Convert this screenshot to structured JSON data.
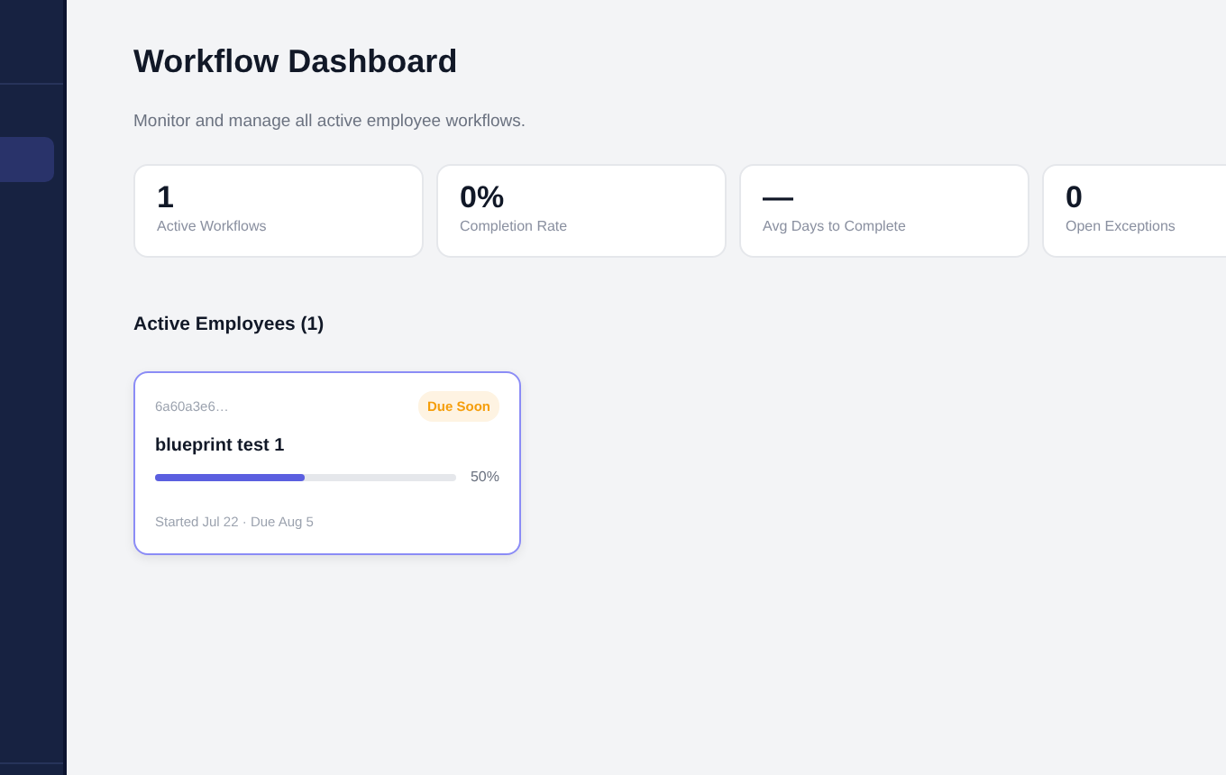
{
  "sidebar": {
    "items": [
      {
        "selected": true
      }
    ]
  },
  "page": {
    "title": "Workflow Dashboard",
    "subtitle": "Monitor and manage all active employee workflows."
  },
  "stats": [
    {
      "value": "1",
      "label": "Active Workflows"
    },
    {
      "value": "0%",
      "label": "Completion Rate"
    },
    {
      "value": "—",
      "label": "Avg Days to Complete"
    },
    {
      "value": "0",
      "label": "Open Exceptions"
    }
  ],
  "section": {
    "title": "Active Employees (1)"
  },
  "employees": [
    {
      "id": "6a60a3e6…",
      "badge": "Due Soon",
      "name": "blueprint test 1",
      "level": 0.5,
      "percent": "50%",
      "dates": "Started Jul 22 · Due Aug 5",
      "selected": true
    }
  ]
}
